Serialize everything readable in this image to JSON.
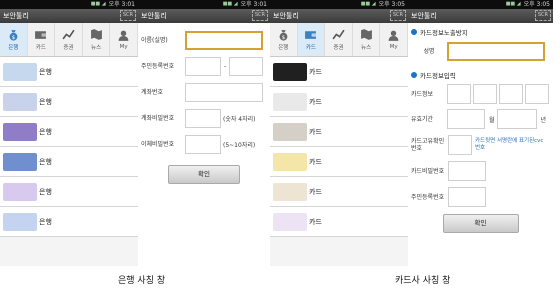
{
  "status": {
    "time1": "오후 3:01",
    "time2": "오후 3:05",
    "sig": "■■ ◢"
  },
  "app_title": "보안툴리",
  "scr_label": "SCR",
  "tabs": [
    {
      "label": "은행",
      "icon": "money-bag-icon"
    },
    {
      "label": "카드",
      "icon": "wallet-icon"
    },
    {
      "label": "증권",
      "icon": "chart-icon"
    },
    {
      "label": "뉴스",
      "icon": "map-icon"
    },
    {
      "label": "My",
      "icon": "person-icon"
    }
  ],
  "bank_list": [
    {
      "label": "은행",
      "color": "#c6d8ee"
    },
    {
      "label": "은행",
      "color": "#c8d2ea"
    },
    {
      "label": "은행",
      "color": "#8f7dc7"
    },
    {
      "label": "은행",
      "color": "#6f8fcf"
    },
    {
      "label": "은행",
      "color": "#d8c9ee"
    },
    {
      "label": "은행",
      "color": "#c4d4f0"
    }
  ],
  "bank_form": {
    "fields": [
      {
        "label": "이름(실명)"
      },
      {
        "label": "주민등록번호"
      },
      {
        "label": "계좌번호"
      },
      {
        "label": "계좌비밀번호",
        "note": "(숫자 4자리)"
      },
      {
        "label": "이체비밀번호",
        "note": "(5~10자리)"
      }
    ],
    "dash": "-",
    "confirm": "확인"
  },
  "card_list": [
    {
      "label": "카드",
      "color": "#202020"
    },
    {
      "label": "카드",
      "color": "#e9e9e9"
    },
    {
      "label": "카드",
      "color": "#d4d0c8"
    },
    {
      "label": "카드",
      "color": "#f3e6a8"
    },
    {
      "label": "카드",
      "color": "#eee4d4"
    },
    {
      "label": "카드",
      "color": "#ece4f4"
    }
  ],
  "card_form": {
    "section1": "카드정보노출방지",
    "name_label": "성명",
    "section2": "카드정보입력",
    "card_info_label": "카드정보",
    "expiry_label": "유효기간",
    "month": "월",
    "year": "년",
    "cvc_label": "카드고유확인번호",
    "cvc_link": "카드뒷면 서명란에 표기된cvc번호",
    "pw_label": "카드비밀번호",
    "rrn_label": "주민등록번호",
    "confirm": "확인"
  },
  "captions": {
    "bank": "은행 사칭 창",
    "card": "카드사 사칭 창"
  }
}
